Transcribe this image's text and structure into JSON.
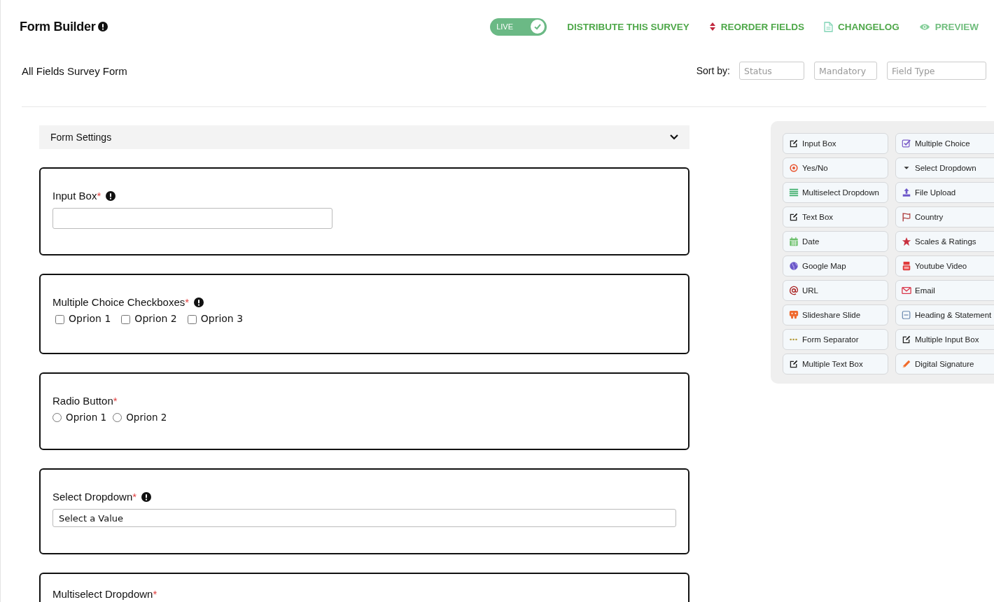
{
  "header": {
    "title": "Form Builder",
    "info": true,
    "live_toggle": {
      "label": "LIVE",
      "on": true
    },
    "actions": [
      {
        "label": "DISTRIBUTE THIS SURVEY",
        "kind": "plain"
      },
      {
        "label": "REORDER FIELDS",
        "kind": "reorder"
      },
      {
        "label": "CHANGELOG",
        "kind": "changelog"
      },
      {
        "label": "PREVIEW",
        "kind": "preview"
      }
    ]
  },
  "form_name": "All Fields Survey Form",
  "sort": {
    "label": "Sort by:",
    "filters": [
      {
        "placeholder": "Status"
      },
      {
        "placeholder": "Mandatory"
      },
      {
        "placeholder": "Field Type"
      }
    ]
  },
  "settings_panel": {
    "label": "Form Settings",
    "expanded": false
  },
  "fields": [
    {
      "kind": "input",
      "label": "Input Box",
      "required_mark": "*",
      "info": true
    },
    {
      "kind": "checkboxes",
      "label": "Multiple Choice Checkboxes",
      "required_mark": "*",
      "info": true,
      "options": [
        {
          "label": "Oprion 1",
          "checked": false
        },
        {
          "label": "Oprion 2",
          "checked": false
        },
        {
          "label": "Oprion 3",
          "checked": false
        }
      ]
    },
    {
      "kind": "radio",
      "label": "Radio Button",
      "required_mark": "*",
      "info": false,
      "options": [
        {
          "label": "Oprion 1",
          "selected": false
        },
        {
          "label": "Oprion 2",
          "selected": false
        }
      ]
    },
    {
      "kind": "select",
      "label": "Select Dropdown",
      "required_mark": "*",
      "info": true,
      "value": "Select a Value"
    },
    {
      "kind": "multiselect",
      "label": "Multiselect Dropdown",
      "required_mark": "*",
      "info": false
    }
  ],
  "palette": [
    {
      "label": "Input Box",
      "kind": "edit"
    },
    {
      "label": "Multiple Choice",
      "kind": "check"
    },
    {
      "label": "Yes/No",
      "kind": "target"
    },
    {
      "label": "Select Dropdown",
      "kind": "caret"
    },
    {
      "label": "Multiselect Dropdown",
      "kind": "list"
    },
    {
      "label": "File Upload",
      "kind": "upload"
    },
    {
      "label": "Text Box",
      "kind": "edit"
    },
    {
      "label": "Country",
      "kind": "flag"
    },
    {
      "label": "Date",
      "kind": "calendar"
    },
    {
      "label": "Scales & Ratings",
      "kind": "star"
    },
    {
      "label": "Google Map",
      "kind": "globe"
    },
    {
      "label": "Youtube Video",
      "kind": "video"
    },
    {
      "label": "URL",
      "kind": "at"
    },
    {
      "label": "Email",
      "kind": "envelope"
    },
    {
      "label": "Slideshare Slide",
      "kind": "slides"
    },
    {
      "label": "Heading & Statement",
      "kind": "heading"
    },
    {
      "label": "Form Separator",
      "kind": "dots"
    },
    {
      "label": "Multiple Input Box",
      "kind": "edit"
    },
    {
      "label": "Multiple Text Box",
      "kind": "edit"
    },
    {
      "label": "Digital Signature",
      "kind": "pencil"
    }
  ]
}
